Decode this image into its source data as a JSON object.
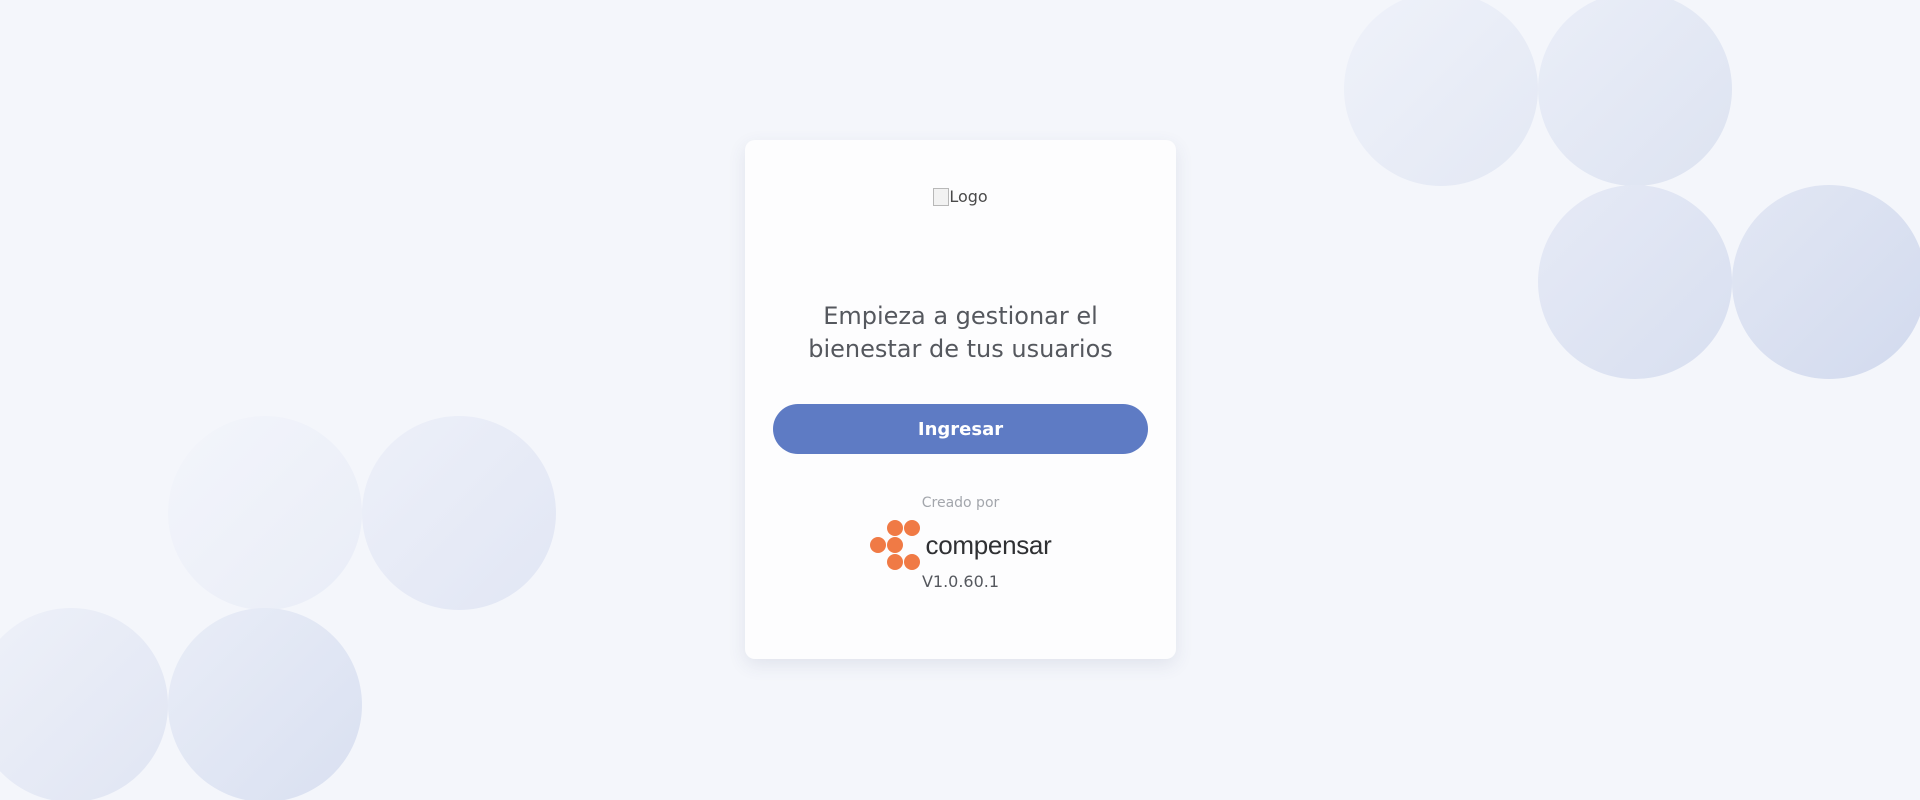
{
  "logo": {
    "alt": "Logo"
  },
  "card": {
    "heading_line1": "Empieza a gestionar el",
    "heading_line2": "bienestar de tus usuarios",
    "login_button_label": "Ingresar",
    "created_by_label": "Creado por",
    "brand_name": "compensar",
    "version": "V1.0.60.1"
  },
  "colors": {
    "background": "#f4f6fb",
    "card": "#fdfdfe",
    "primary_button": "#5e7bc4",
    "brand_orange": "#f07a45",
    "heading_text": "#55585e"
  },
  "icons": {
    "broken_logo": "broken-image-icon",
    "brand_mark": "compensar-dots-icon"
  }
}
